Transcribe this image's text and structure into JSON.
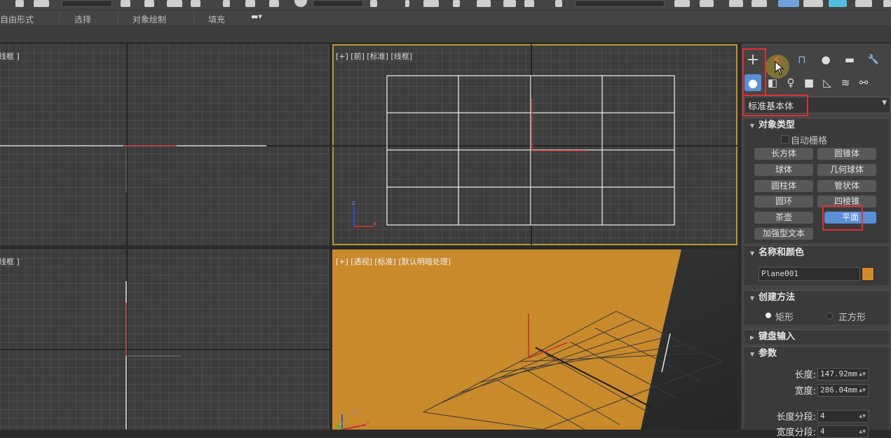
{
  "ribbon": {
    "tabs": [
      "自由形式",
      "选择",
      "对象绘制",
      "填充"
    ]
  },
  "viewports": {
    "top_left_label": "线框 ]",
    "front_label": "[+] [前] [标准] [线框]",
    "bottom_left_label": "线框 ]",
    "perspective_label": "[+] [透视] [标准] [默认明暗处理]",
    "axis_x": "x",
    "axis_y": "y",
    "axis_z": "z"
  },
  "panel": {
    "tabs": [
      {
        "name": "create",
        "glyph": "+"
      },
      {
        "name": "modify",
        "glyph": "◐"
      },
      {
        "name": "hierarchy",
        "glyph": "⊓"
      },
      {
        "name": "motion",
        "glyph": "●"
      },
      {
        "name": "display",
        "glyph": "▬"
      },
      {
        "name": "utilities",
        "glyph": "🔧"
      }
    ],
    "category_icons": [
      "●",
      "◧",
      "♀",
      "■",
      "◺",
      "≋",
      "⚯"
    ],
    "dropdown_value": "标准基本体",
    "object_type": {
      "title": "对象类型",
      "auto_grid": "自动栅格",
      "buttons": [
        "长方体",
        "圆锥体",
        "球体",
        "几何球体",
        "圆柱体",
        "管状体",
        "圆环",
        "四棱锥",
        "茶壶",
        "平面",
        "加强型文本"
      ],
      "selected": "平面"
    },
    "name_color": {
      "title": "名称和颜色",
      "name": "Plane001",
      "color": "#d08b2c"
    },
    "creation_method": {
      "title": "创建方法",
      "options": [
        "矩形",
        "正方形"
      ]
    },
    "keyboard_input": {
      "title": "键盘输入"
    },
    "parameters": {
      "title": "参数",
      "length_label": "长度:",
      "length_value": "147.92mm",
      "width_label": "宽度:",
      "width_value": "286.04mm",
      "length_segs_label": "长度分段:",
      "length_segs_value": "4",
      "width_segs_label": "宽度分段:",
      "width_segs_value": "4"
    }
  },
  "colors": {
    "accent_blue": "#5b8fd6",
    "highlight_red": "#e03030",
    "active_viewport": "#b8962e",
    "plane_orange": "#c98a2c"
  }
}
